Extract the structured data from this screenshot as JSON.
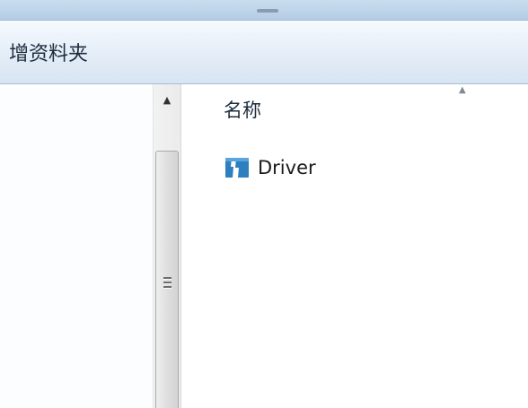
{
  "toolbar": {
    "new_folder_label": "增资料夹"
  },
  "scrollbar": {
    "up_arrow": "▲"
  },
  "columns": {
    "name_header": "名称",
    "sort_indicator": "▲"
  },
  "files": [
    {
      "name": "Driver",
      "icon": "driver-folder-icon"
    }
  ],
  "colors": {
    "toolbar_bg": "#dde8f4",
    "icon_blue": "#2e7fc0"
  }
}
